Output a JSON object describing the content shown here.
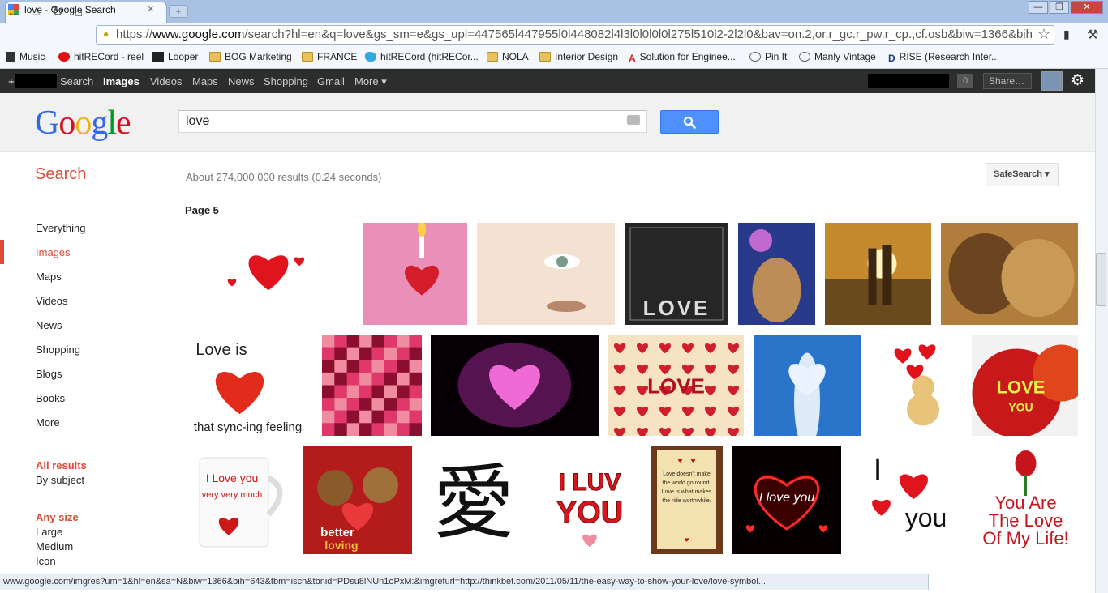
{
  "browser": {
    "tab_title": "love - Google Search",
    "tab_close": "×",
    "new_tab": "+",
    "win_min": "—",
    "win_max": "❐",
    "win_close": "✕",
    "url_prefix": "https://",
    "url_host": "www.google.com",
    "url_rest": "/search?hl=en&q=love&gs_sm=e&gs_upl=447565l447955l0l448082l4l3l0l0l0l0l275l510l2-2l2l0&bav=on.2,or.r_gc.r_pw.r_cp.,cf.osb&biw=1366&bih",
    "bookmarks": [
      {
        "label": "Music"
      },
      {
        "label": "hitRECord - reel"
      },
      {
        "label": "Looper"
      },
      {
        "label": "BOG Marketing"
      },
      {
        "label": "FRANCE"
      },
      {
        "label": "hitRECord (hitRECor..."
      },
      {
        "label": "NOLA"
      },
      {
        "label": "Interior Design"
      },
      {
        "label": "Solution for Enginee..."
      },
      {
        "label": "Pin It"
      },
      {
        "label": "Manly Vintage"
      },
      {
        "label": "RISE (Research Inter..."
      }
    ],
    "status_url": "www.google.com/imgres?um=1&hl=en&sa=N&biw=1366&bih=643&tbm=isch&tbnid=PDsu8lNUn1oPxM:&imgrefurl=http://thinkbet.com/2011/05/11/the-easy-way-to-show-your-love/love-symbol..."
  },
  "gbar": {
    "plus": "+",
    "items": [
      "Search",
      "Images",
      "Videos",
      "Maps",
      "News",
      "Shopping",
      "Gmail",
      "More ▾"
    ],
    "notifications": "0",
    "share": "Share…"
  },
  "search": {
    "logo_letters": [
      {
        "ch": "G",
        "color": "#3369e8"
      },
      {
        "ch": "o",
        "color": "#d50f25"
      },
      {
        "ch": "o",
        "color": "#eeb211"
      },
      {
        "ch": "g",
        "color": "#3369e8"
      },
      {
        "ch": "l",
        "color": "#009925"
      },
      {
        "ch": "e",
        "color": "#d50f25"
      }
    ],
    "query": "love",
    "label": "Search",
    "result_stats": "About 274,000,000 results (0.24 seconds)",
    "safesearch": "SafeSearch ▾",
    "page_label": "Page 5"
  },
  "left_nav": {
    "items": [
      "Everything",
      "Images",
      "Maps",
      "Videos",
      "News",
      "Shopping",
      "Blogs",
      "Books",
      "More"
    ],
    "all_results": "All results",
    "by_subject": "By subject",
    "any_size": "Any size",
    "sizes": [
      "Large",
      "Medium",
      "Icon"
    ]
  },
  "thumbnails": [
    {
      "name": "red-hearts",
      "kind": "hearts",
      "bg": "#ffffff",
      "fg": "#e0141c"
    },
    {
      "name": "candle-heart-poem",
      "kind": "candle",
      "bg": "#e98fb8",
      "fg": "#d41c2a"
    },
    {
      "name": "face-poem",
      "kind": "face",
      "bg": "#f3e1d2",
      "fg": "#b9876a"
    },
    {
      "name": "love-poster-dark",
      "kind": "lovedark",
      "bg": "#262626",
      "fg": "#dddddd",
      "text": "LOVE"
    },
    {
      "name": "fantasy-painting",
      "kind": "fantasy",
      "bg": "#2a3a8a",
      "fg": "#e2a24a"
    },
    {
      "name": "sunset-couple",
      "kind": "sunset",
      "bg": "#c58a2e",
      "fg": "#3a2611"
    },
    {
      "name": "lions",
      "kind": "lions",
      "bg": "#b07d3d",
      "fg": "#6b4520"
    },
    {
      "name": "love-is-syncing",
      "kind": "loveis",
      "bg": "#ffffff",
      "fg": "#e22b1a",
      "text": "Love is",
      "text2": "that sync-ing feeling"
    },
    {
      "name": "heart-pattern-quilt",
      "kind": "quilt",
      "bg": "#c3164a",
      "fg": "#f08ca0"
    },
    {
      "name": "pink-glow-heart",
      "kind": "glow",
      "bg": "#060006",
      "fg": "#f06ad6"
    },
    {
      "name": "love-many-hearts",
      "kind": "manyhearts",
      "bg": "#f6e3c4",
      "fg": "#cf1f2b",
      "text": "LOVE"
    },
    {
      "name": "sky-heart-cloud",
      "kind": "sky",
      "bg": "#2a74c9",
      "fg": "#ffffff"
    },
    {
      "name": "teddy-bear-balloons",
      "kind": "teddy",
      "bg": "#ffffff",
      "fg": "#e2121c"
    },
    {
      "name": "apple-love",
      "kind": "apple",
      "bg": "#f2f2f2",
      "fg": "#c8191a",
      "text": "LOVE",
      "text2": "YOU"
    },
    {
      "name": "i-love-you-mug",
      "kind": "mug",
      "bg": "#ffffff",
      "fg": "#cc1818",
      "text": "I Love you",
      "text2": "very very much"
    },
    {
      "name": "teddy-bears-better-loving",
      "kind": "bears",
      "bg": "#b41c1c",
      "fg": "#f2c23a",
      "text": "better",
      "text2": "loving"
    },
    {
      "name": "kanji-love",
      "kind": "kanji",
      "bg": "#ffffff",
      "fg": "#111111",
      "text": "愛"
    },
    {
      "name": "i-luv-you",
      "kind": "iluv",
      "bg": "#ffffff",
      "fg": "#d8141c",
      "text": "I LUV",
      "text2": "YOU"
    },
    {
      "name": "scroll-love-quote",
      "kind": "scroll",
      "bg": "#6a3a1a",
      "fg": "#f4e1b0",
      "text": "Love doesn't make the world go round. Love is what makes the ride worthwhile."
    },
    {
      "name": "neon-i-love-you",
      "kind": "neon",
      "bg": "#060000",
      "fg": "#ff2a2a",
      "text": "I love you"
    },
    {
      "name": "i-heart-you",
      "kind": "iheart",
      "bg": "#ffffff",
      "fg": "#e0141c",
      "text": "I",
      "text2": "you"
    },
    {
      "name": "you-are-love-of-my-life",
      "kind": "rose",
      "bg": "#ffffff",
      "fg": "#c8141c",
      "text": "You Are",
      "text2": "The Love",
      "text3": "Of My Life!"
    }
  ]
}
